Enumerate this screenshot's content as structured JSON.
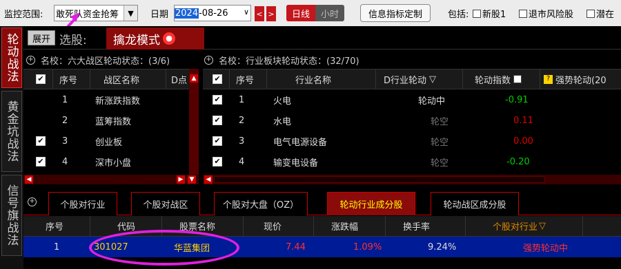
{
  "toolbar": {
    "scope_label": "监控范围:",
    "scope_value": "敢死队资金抢筹",
    "date_label": "日期",
    "date_year_selected": "2024",
    "date_rest": "-08-26",
    "prev": "<",
    "next": ">",
    "period_on": "日线",
    "period_off": "小时",
    "custom_btn": "信息指标定制",
    "include_label": "包括:",
    "opt_new": "新股1",
    "opt_delist": "退市风险股",
    "opt_latent": "潜在"
  },
  "vtabs": [
    {
      "label": "轮动战法",
      "active": true
    },
    {
      "label": "黄金坑战法",
      "active": false
    },
    {
      "label": "信号旗战法",
      "active": false
    }
  ],
  "header": {
    "expand": "展开",
    "pick": "选股:",
    "mode": "擒龙模式",
    "lock": "🔒"
  },
  "left_panel": {
    "title": "名校：六大战区轮动状态：(3/6)",
    "cols": [
      "序号",
      "战区名称",
      "D点"
    ],
    "rows": [
      {
        "checked": false,
        "idx": "1",
        "name": "新涨跌指数"
      },
      {
        "checked": false,
        "idx": "2",
        "name": "蓝筹指数"
      },
      {
        "checked": true,
        "idx": "3",
        "name": "创业板"
      },
      {
        "checked": true,
        "idx": "4",
        "name": "深市小盘"
      }
    ]
  },
  "right_panel": {
    "title": "名校：行业板块轮动状态：(32/70)",
    "cols": [
      "序号",
      "行业名称",
      "D行业轮动",
      "轮动指数",
      "强势轮动(20"
    ],
    "rows": [
      {
        "idx": "1",
        "name": "火电",
        "status": "轮动中",
        "index": "-0.91",
        "color": "#00d000",
        "status_color": "#ddd"
      },
      {
        "idx": "2",
        "name": "水电",
        "status": "轮空",
        "index": "0.11",
        "color": "#e00000",
        "status_color": "#777"
      },
      {
        "idx": "3",
        "name": "电气电源设备",
        "status": "轮空",
        "index": "0.00",
        "color": "#e00000",
        "status_color": "#777"
      },
      {
        "idx": "4",
        "name": "输变电设备",
        "status": "轮空",
        "index": "-0.20",
        "color": "#00d000",
        "status_color": "#777"
      }
    ]
  },
  "tabs": [
    {
      "label": "个股对行业",
      "active": false
    },
    {
      "label": "个股对战区",
      "active": false
    },
    {
      "label": "个股对大盘（OZ）",
      "active": false
    },
    {
      "label": "轮动行业成分股",
      "active": true
    },
    {
      "label": "轮动战区成分股",
      "active": false
    }
  ],
  "stock_table": {
    "cols": [
      "序号",
      "代码",
      "股票名称",
      "现价",
      "涨跌幅",
      "换手率",
      "个股对行业"
    ],
    "row": {
      "idx": "1",
      "code": "301027",
      "name": "华蓝集团",
      "price": "7.44",
      "change": "1.09%",
      "turnover": "9.24%",
      "status": "强势轮动中"
    }
  },
  "colors": {
    "accent": "#8b0a0a",
    "highlight_row": "#001b96",
    "annotation": "#e020e0"
  }
}
